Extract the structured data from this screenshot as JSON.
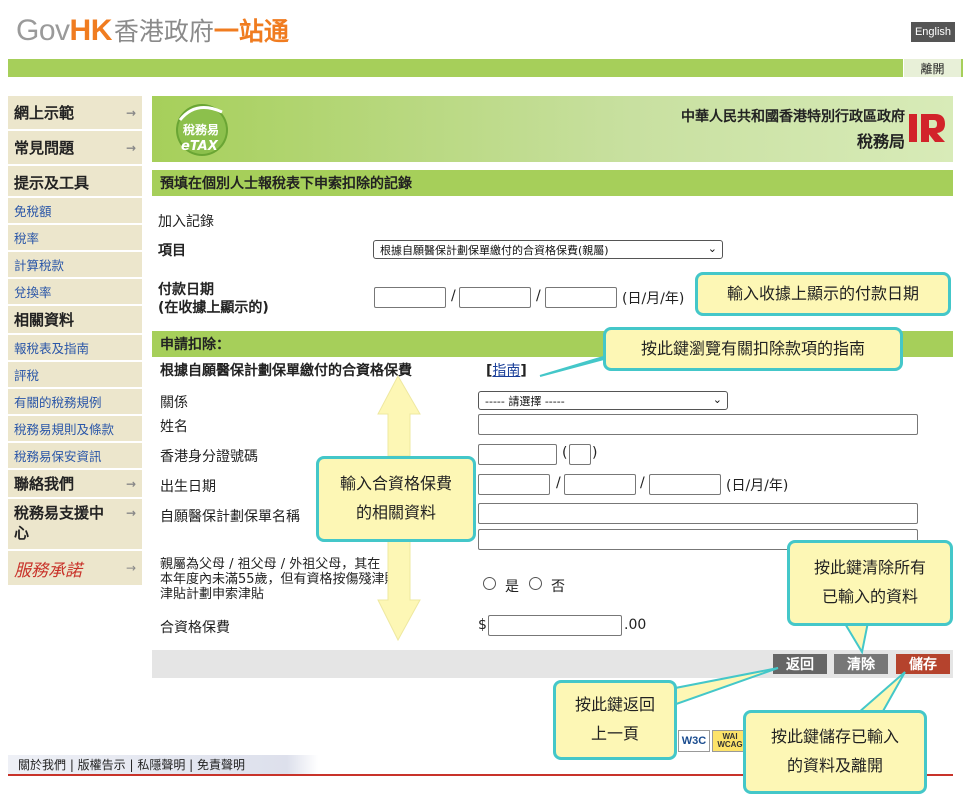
{
  "header": {
    "logo_gov": "Gov",
    "logo_hk": "HK",
    "logo_cn_gray": "香港政府",
    "logo_cn_orange": "一站通",
    "lang_button": "English",
    "exit_link": "離開"
  },
  "sidebar": {
    "items": [
      {
        "label": "網上示範",
        "type": "head"
      },
      {
        "label": "常見問題",
        "type": "head"
      },
      {
        "label": "提示及工具",
        "type": "head"
      },
      {
        "label": "免稅額",
        "type": "link"
      },
      {
        "label": "稅率",
        "type": "link"
      },
      {
        "label": "計算稅款",
        "type": "link"
      },
      {
        "label": "兌換率",
        "type": "link"
      },
      {
        "label": "相關資料",
        "type": "head"
      },
      {
        "label": "報稅表及指南",
        "type": "link"
      },
      {
        "label": "評稅",
        "type": "link"
      },
      {
        "label": "有關的稅務規例",
        "type": "link"
      },
      {
        "label": "稅務易規則及條款",
        "type": "link"
      },
      {
        "label": "稅務易保安資訊",
        "type": "link"
      },
      {
        "label": "聯絡我們",
        "type": "head"
      },
      {
        "label": "稅務易支援中心",
        "type": "head"
      },
      {
        "label": "服務承諾",
        "type": "stamp"
      }
    ]
  },
  "banner": {
    "etax_cn": "稅務易",
    "etax_en": "eTAX",
    "dept_line1": "中華人民共和國香港特別行政區政府",
    "dept_line2": "稅務局"
  },
  "form": {
    "section_title": "預填在個別人士報稅表下申索扣除的記錄",
    "add_record": "加入記錄",
    "item_label": "項目",
    "item_value": "根據自願醫保計劃保單繳付的合資格保費(親屬)",
    "payment_date_label_1": "付款日期",
    "payment_date_label_2": "(在收據上顯示的)",
    "date_sep": "/",
    "date_format": "(日/月/年)",
    "claim_section": "申請扣除：",
    "claim_title": "根據自願醫保計劃保單繳付的合資格保費",
    "guide_link_open": "[",
    "guide_link": "指南",
    "guide_link_close": "]",
    "relation_label": "關係",
    "relation_value": "----- 請選擇 -----",
    "name_label": "姓名",
    "hkid_label": "香港身分證號碼",
    "hkid_paren_open": "(",
    "hkid_paren_close": ")",
    "dob_label": "出生日期",
    "dob_format": "(日/月/年)",
    "policy_label": "自願醫保計劃保單名稱",
    "parent_question_1": "親屬為父母 / 祖父母 / 外祖父母，其在",
    "parent_question_2": "本年度內未滿55歲，但有資格按傷殘津貼",
    "parent_question_3": "津貼計劃申索津貼",
    "yes_label": "是",
    "no_label": "否",
    "premium_label": "合資格保費",
    "currency": "$",
    "cents": ".00"
  },
  "buttons": {
    "back": "返回",
    "clear": "清除",
    "save": "儲存"
  },
  "callouts": {
    "payment_date": "輸入收據上顯示的付款日期",
    "guide": "按此鍵瀏覽有關扣除款項的指南",
    "premium_info_1": "輸入合資格保費",
    "premium_info_2": "的相關資料",
    "clear_1": "按此鍵清除所有",
    "clear_2": "已輸入的資料",
    "back_1": "按此鍵返回",
    "back_2": "上一頁",
    "save_1": "按此鍵儲存已輸入",
    "save_2": "的資料及離開"
  },
  "footer": {
    "links": "關於我們 | 版權告示 | 私隱聲明 | 免責聲明",
    "w3c": "W3C",
    "wai_1": "WAI",
    "wai_2": "WCAG"
  },
  "colors": {
    "green": "#a6cf5a",
    "orange": "#f07c20",
    "callout_border": "#44c7c9",
    "callout_fill": "#fdf7b5",
    "back_button": "#666666",
    "clear_button": "#777777",
    "save_button": "#b5432d"
  }
}
